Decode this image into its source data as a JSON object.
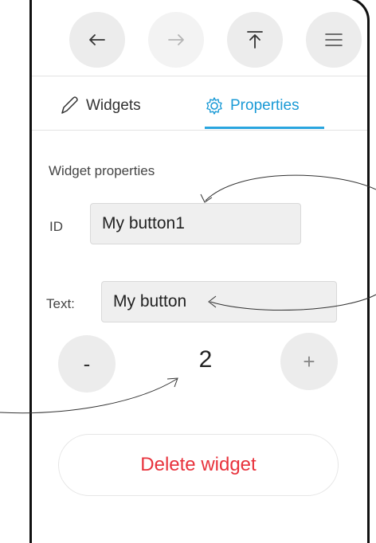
{
  "toolbar": {
    "back_icon": "undo-arrow-icon",
    "forward_icon": "redo-arrow-icon",
    "upload_icon": "upload-icon",
    "menu_icon": "menu-icon"
  },
  "tabs": [
    {
      "label": "Widgets",
      "icon": "pencil-icon",
      "active": false
    },
    {
      "label": "Properties",
      "icon": "gear-icon",
      "active": true
    }
  ],
  "section": {
    "title": "Widget properties"
  },
  "fields": {
    "id": {
      "label": "ID",
      "value": "My button1"
    },
    "text": {
      "label": "Text:",
      "value": "My button"
    }
  },
  "stepper": {
    "minus_label": "-",
    "value": "2",
    "plus_label": "+"
  },
  "actions": {
    "delete_label": "Delete widget"
  },
  "colors": {
    "accent": "#1a9ad6",
    "danger": "#e8323c",
    "frame": "#111111"
  }
}
